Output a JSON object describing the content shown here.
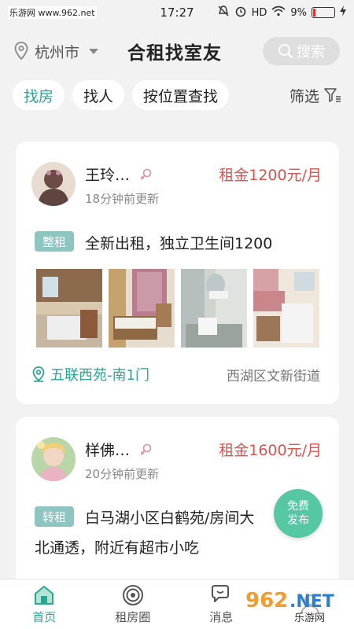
{
  "statusbar": {
    "site_mark": "乐游网 www.962.net",
    "time": "17:27",
    "network": "HD",
    "battery": "9%",
    "battery_level": 0.09
  },
  "header": {
    "city": "杭州市",
    "title": "合租找室友",
    "search_label": "搜索"
  },
  "filters": {
    "chips": [
      {
        "label": "找房",
        "active": true
      },
      {
        "label": "找人",
        "active": false
      },
      {
        "label": "按位置查找",
        "active": false
      }
    ],
    "filter_label": "筛选"
  },
  "listings": [
    {
      "name": "王玲…",
      "updated": "18分钟前更新",
      "rent": "租金1200元/月",
      "tag": "整租",
      "desc": "全新出租，独立卫生间1200",
      "location": "五联西苑-南1门",
      "district": "西湖区文新街道"
    },
    {
      "name": "样佛…",
      "updated": "20分钟前更新",
      "rent": "租金1600元/月",
      "tag": "转租",
      "desc_line1": "白马湖小区白鹤苑/房间大",
      "desc_line2": "北通透，附近有超市小吃"
    }
  ],
  "fab": {
    "line1": "免费",
    "line2": "发布"
  },
  "tabbar": [
    {
      "label": "首页",
      "active": true
    },
    {
      "label": "租房圈",
      "active": false
    },
    {
      "label": "消息",
      "active": false
    }
  ],
  "colors": {
    "accent": "#2aa792",
    "price": "#d9534f",
    "tag_bg": "#8fc5c0",
    "fab": "#55c7a3"
  },
  "watermark": "962.NET 乐游网"
}
